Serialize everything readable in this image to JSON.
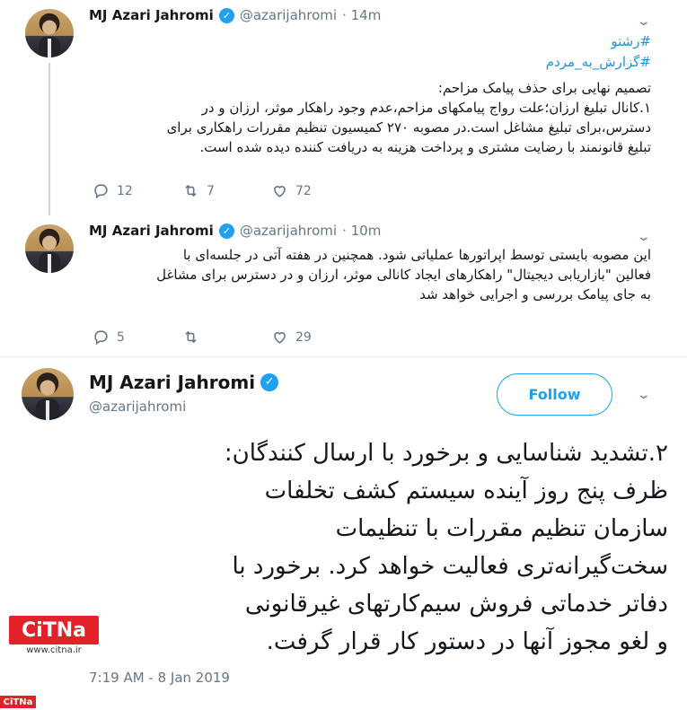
{
  "tweet1": {
    "name": "MJ Azari Jahromi",
    "handle": "@azarijahromi",
    "time": "· 14m",
    "hashtags": [
      "#رشتو",
      "#گزارش_به_مردم"
    ],
    "lines": [
      "تصمیم نهایی برای حذف پیامک مزاحم:",
      "۱.کانال تبلیغ ارزان؛علت رواج پیامکهای مزاحم،عدم وجود راهکار موثر، ارزان و در",
      "دسترس،برای تبلیغ مشاغل است.در مصوبه ۲۷۰ کمیسیون تنظیم مقررات راهکاری برای",
      "تبلیغ قانونمند با رضایت مشتری و پرداخت هزینه به دریافت کننده دیده شده است."
    ],
    "replies": "12",
    "retweets": "7",
    "likes": "72"
  },
  "tweet2": {
    "name": "MJ Azari Jahromi",
    "handle": "@azarijahromi",
    "time": "· 10m",
    "lines": [
      "این مصوبه بایستی توسط اپراتورها عملیاتی شود. همچنین در هفته آتی در جلسه‌ای با",
      "فعالین \"بازاریابی دیجیتال\" راهکارهای ایجاد کانالی موثر، ارزان و در دسترس برای مشاغل",
      "به جای پیامک بررسی و اجرایی خواهد شد"
    ],
    "replies": "5",
    "retweets": "",
    "likes": "29"
  },
  "tweet3": {
    "name": "MJ Azari Jahromi",
    "handle": "@azarijahromi",
    "follow_label": "Follow",
    "lines": [
      "۲.تشدید شناسایی و برخورد با ارسال کنندگان:",
      "ظرف پنج روز آینده سیستم کشف تخلفات",
      "سازمان تنظیم مقررات با تنظیمات",
      "سخت‌گیرانه‌تری فعالیت خواهد کرد. برخورد با",
      "دفاتر خدماتی فروش سیم‌کارتهای غیرقانونی",
      "و لغو مجوز آنها در دستور کار قرار گرفت."
    ],
    "timestamp": "7:19 AM - 8 Jan 2019"
  },
  "watermark": {
    "logo": "CiTNa",
    "url": "www.citna.ir",
    "logo_small": "CiTNa"
  },
  "icons": [
    "verified-badge-icon",
    "chevron-down-icon",
    "reply-icon",
    "retweet-icon",
    "like-icon"
  ],
  "colors": {
    "accent": "#1da1f2",
    "muted": "#657786",
    "brand": "#e32128"
  }
}
